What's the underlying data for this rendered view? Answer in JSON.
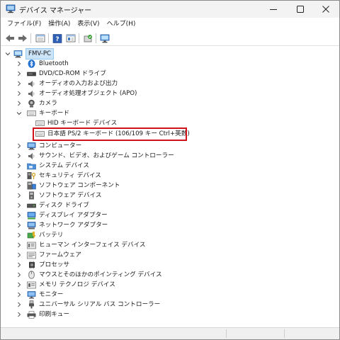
{
  "window": {
    "title": "デバイス マネージャー"
  },
  "menu": [
    "ファイル(F)",
    "操作(A)",
    "表示(V)",
    "ヘルプ(H)"
  ],
  "colors": {
    "selection": "#cce4f7",
    "highlight_border": "#d0121b",
    "folder_icon": "#4a8fd8"
  },
  "toolbar": {
    "buttons": [
      "back-icon",
      "forward-icon",
      "properties-icon",
      "help-icon",
      "update-driver-icon",
      "scan-hardware-icon",
      "monitor-icon"
    ]
  },
  "tree": {
    "root": "FMV-PC",
    "categories": [
      {
        "label": "Bluetooth",
        "icon": "bluetooth-icon",
        "expanded": false
      },
      {
        "label": "DVD/CD-ROM ドライブ",
        "icon": "dvd-drive-icon",
        "expanded": false
      },
      {
        "label": "オーディオの入力および出力",
        "icon": "speaker-icon",
        "expanded": false
      },
      {
        "label": "オーディオ処理オブジェクト (APO)",
        "icon": "speaker-icon",
        "expanded": false
      },
      {
        "label": "カメラ",
        "icon": "camera-icon",
        "expanded": false
      },
      {
        "label": "キーボード",
        "icon": "keyboard-icon",
        "expanded": true,
        "children": [
          "HID キーボード デバイス",
          "日本語 PS/2 キーボード (106/109 キー Ctrl+英数)"
        ]
      },
      {
        "label": "コンピューター",
        "icon": "computer-icon",
        "expanded": false
      },
      {
        "label": "サウンド、ビデオ、およびゲーム コントローラー",
        "icon": "speaker-icon",
        "expanded": false
      },
      {
        "label": "システム デバイス",
        "icon": "system-folder-icon",
        "expanded": false
      },
      {
        "label": "セキュリティ デバイス",
        "icon": "security-icon",
        "expanded": false
      },
      {
        "label": "ソフトウェア コンポーネント",
        "icon": "software-component-icon",
        "expanded": false
      },
      {
        "label": "ソフトウェア デバイス",
        "icon": "software-device-icon",
        "expanded": false
      },
      {
        "label": "ディスク ドライブ",
        "icon": "disk-drive-icon",
        "expanded": false
      },
      {
        "label": "ディスプレイ アダプター",
        "icon": "display-adapter-icon",
        "expanded": false
      },
      {
        "label": "ネットワーク アダプター",
        "icon": "network-adapter-icon",
        "expanded": false
      },
      {
        "label": "バッテリ",
        "icon": "battery-icon",
        "expanded": false
      },
      {
        "label": "ヒューマン インターフェイス デバイス",
        "icon": "hid-icon",
        "expanded": false
      },
      {
        "label": "ファームウェア",
        "icon": "firmware-icon",
        "expanded": false
      },
      {
        "label": "プロセッサ",
        "icon": "processor-icon",
        "expanded": false
      },
      {
        "label": "マウスとそのほかのポインティング デバイス",
        "icon": "mouse-icon",
        "expanded": false
      },
      {
        "label": "メモリ テクノロジ デバイス",
        "icon": "memory-icon",
        "expanded": false
      },
      {
        "label": "モニター",
        "icon": "monitor-icon",
        "expanded": false
      },
      {
        "label": "ユニバーサル シリアル バス コントローラー",
        "icon": "usb-icon",
        "expanded": false
      },
      {
        "label": "印刷キュー",
        "icon": "printer-icon",
        "expanded": false
      }
    ]
  }
}
